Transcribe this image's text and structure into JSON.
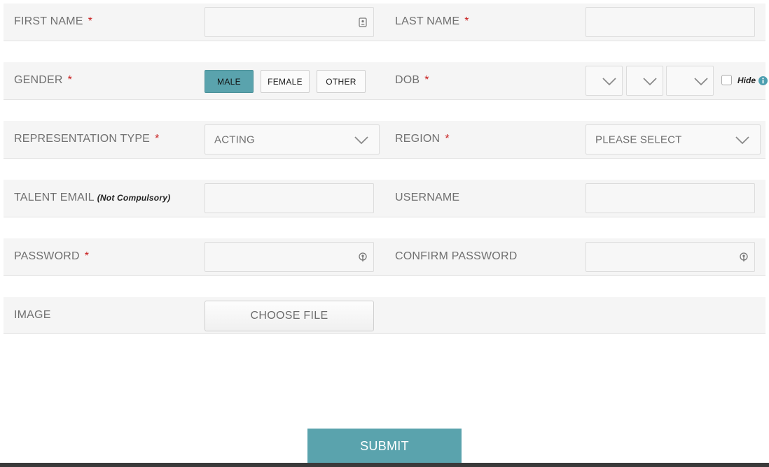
{
  "form": {
    "first_name": {
      "label": "FIRST NAME",
      "required": "*",
      "value": ""
    },
    "last_name": {
      "label": "LAST NAME",
      "required": "*",
      "value": ""
    },
    "gender": {
      "label": "GENDER",
      "required": "*",
      "options": [
        "MALE",
        "FEMALE",
        "OTHER"
      ],
      "selected": "MALE"
    },
    "dob": {
      "label": "DOB",
      "required": "*",
      "hide_label": "Hide",
      "hide_checked": false
    },
    "representation_type": {
      "label": "REPRESENTATION TYPE",
      "required": "*",
      "value": "ACTING"
    },
    "region": {
      "label": "REGION",
      "required": "*",
      "value": "PLEASE SELECT"
    },
    "talent_email": {
      "label": "TALENT EMAIL",
      "note": "(Not Compulsory)",
      "value": ""
    },
    "username": {
      "label": "USERNAME",
      "value": ""
    },
    "password": {
      "label": "PASSWORD",
      "required": "*",
      "value": ""
    },
    "confirm_password": {
      "label": "CONFIRM PASSWORD",
      "value": ""
    },
    "image": {
      "label": "IMAGE",
      "button_label": "CHOOSE FILE"
    },
    "submit_label": "SUBMIT"
  },
  "icons": {
    "first_name_field": "contact-card-icon",
    "password_field": "key-icon",
    "select": "chevron-down-icon",
    "hide_info": "info-icon"
  },
  "colors": {
    "accent": "#5aa3ad",
    "required": "#c81c1c",
    "row_background": "#f5f5f5"
  }
}
